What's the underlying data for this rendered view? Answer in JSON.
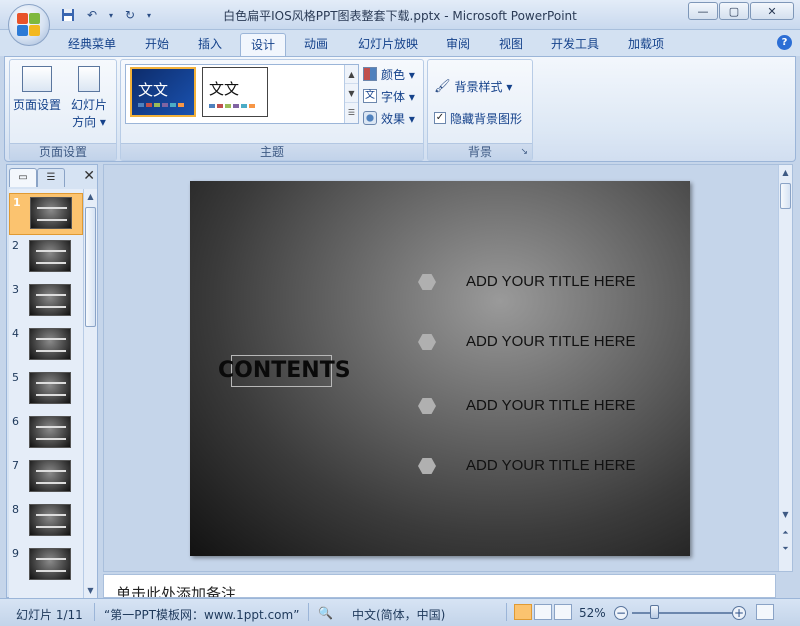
{
  "window": {
    "title": "白色扁平IOS风格PPT图表整套下载.pptx - Microsoft PowerPoint",
    "minimize": "—",
    "maximize": "▢",
    "close": "✕"
  },
  "qat": {
    "save_icon": "save-icon",
    "undo_icon": "undo-icon",
    "redo_icon": "redo-icon"
  },
  "tabs": [
    {
      "label": "经典菜单"
    },
    {
      "label": "开始"
    },
    {
      "label": "插入"
    },
    {
      "label": "设计",
      "active": true
    },
    {
      "label": "动画"
    },
    {
      "label": "幻灯片放映"
    },
    {
      "label": "审阅"
    },
    {
      "label": "视图"
    },
    {
      "label": "开发工具"
    },
    {
      "label": "加载项"
    }
  ],
  "help": "?",
  "ribbon": {
    "page_setup": {
      "group_label": "页面设置",
      "page_setup_label": "页面设置",
      "orientation_line1": "幻灯片",
      "orientation_line2": "方向 ▾"
    },
    "themes": {
      "group_label": "主题",
      "theme1_text": "文文",
      "theme2_text": "文文",
      "colors_label": "颜色 ▾",
      "fonts_label": "字体 ▾",
      "effects_label": "效果 ▾"
    },
    "background": {
      "group_label": "背景",
      "styles_label": "背景样式 ▾",
      "hide_graphics_label": "隐藏背景图形",
      "hide_graphics_checked": true
    }
  },
  "left_panel": {
    "close": "✕",
    "slides": [
      {
        "num": "1",
        "active": true
      },
      {
        "num": "2"
      },
      {
        "num": "3"
      },
      {
        "num": "4"
      },
      {
        "num": "5"
      },
      {
        "num": "6"
      },
      {
        "num": "7"
      },
      {
        "num": "8"
      },
      {
        "num": "9"
      }
    ]
  },
  "slide": {
    "heading": "CONTENTS",
    "items": [
      "ADD YOUR TITLE HERE",
      "ADD YOUR TITLE HERE",
      "ADD YOUR TITLE HERE",
      "ADD YOUR TITLE HERE"
    ]
  },
  "notes": {
    "placeholder": "单击此处添加备注"
  },
  "status": {
    "slide_pos": "幻灯片 1/11",
    "theme_name": "“第一PPT模板网：www.1ppt.com”",
    "language": "中文(简体，中国)",
    "zoom": "52%"
  }
}
